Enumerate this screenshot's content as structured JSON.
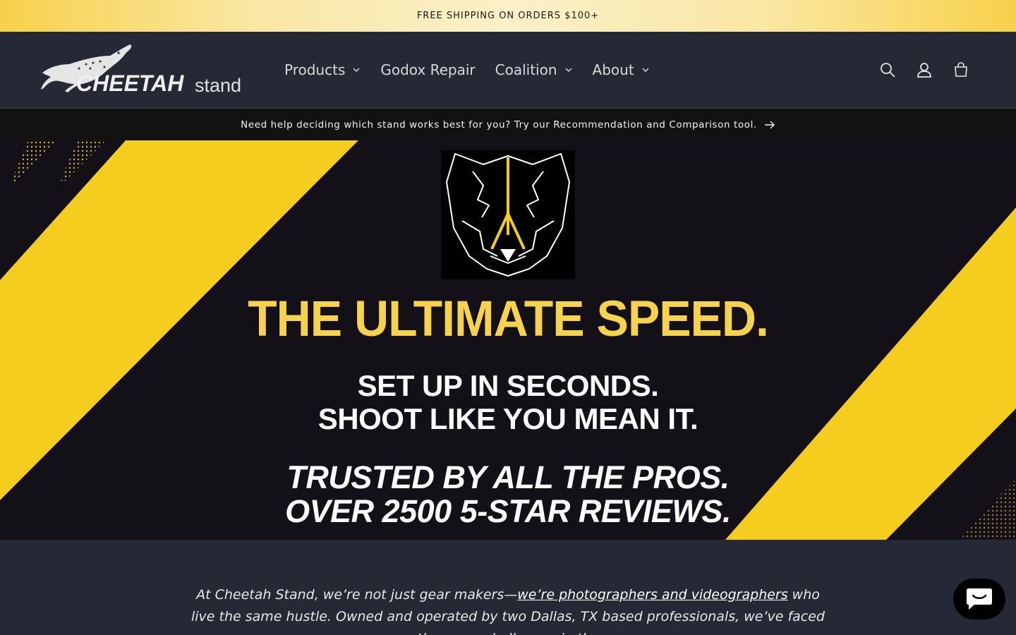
{
  "announcement": {
    "text": "FREE SHIPPING ON ORDERS $100+"
  },
  "header": {
    "logo": {
      "text_main": "CHEETAH",
      "text_sub": "stand"
    },
    "nav": [
      {
        "label": "Products",
        "has_dropdown": true
      },
      {
        "label": "Godox Repair",
        "has_dropdown": false
      },
      {
        "label": "Coalition",
        "has_dropdown": true
      },
      {
        "label": "About",
        "has_dropdown": true
      }
    ],
    "icons": [
      "search-icon",
      "account-icon",
      "cart-icon"
    ]
  },
  "helper_bar": {
    "text": "Need help deciding which stand works best for you? Try our Recommendation and Comparison tool."
  },
  "hero": {
    "headline": "THE ULTIMATE SPEED.",
    "line1": "SET UP IN SECONDS.",
    "line2": "SHOOT LIKE YOU MEAN IT.",
    "line3": "TRUSTED BY ALL THE PROS.",
    "line4": "OVER 2500 5-STAR REVIEWS."
  },
  "intro": {
    "prefix": "At Cheetah Stand, we’re not just gear makers—",
    "link": "we’re photographers and videographers",
    "suffix": " who live the same hustle. Owned and operated by two Dallas, TX based professionals, we’ve faced the same challenges in the"
  },
  "colors": {
    "accent_yellow": "#f7d24c",
    "stripe_yellow": "#f5cd1e",
    "header_bg": "#252936",
    "hero_dark": "#141018"
  }
}
